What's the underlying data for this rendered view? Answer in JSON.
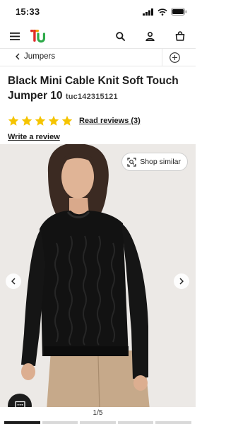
{
  "status_bar": {
    "time": "15:33"
  },
  "breadcrumb": {
    "label": "Jumpers"
  },
  "product": {
    "title": "Black Mini Cable Knit Soft Touch Jumper 10",
    "code": "tuc142315121",
    "rating": {
      "stars": 5,
      "reviews_label": "Read reviews (3)"
    },
    "write_review_label": "Write a review"
  },
  "gallery": {
    "shop_similar_label": "Shop similar",
    "pager": "1/5"
  },
  "colors": {
    "star": "#f5c400",
    "brand_green": "#2eaa4a",
    "brand_red": "#e02b2b",
    "brand_orange": "#f59c00",
    "jumper": "#121212",
    "trousers": "#c6a98a"
  },
  "icons": [
    "menu-icon",
    "search-icon",
    "account-icon",
    "basket-icon",
    "chevron-left-icon",
    "plus-circle-icon",
    "star-icon",
    "visual-search-icon",
    "chat-icon"
  ]
}
